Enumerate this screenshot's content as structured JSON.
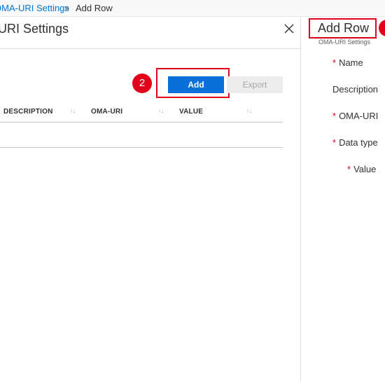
{
  "breadcrumb": {
    "parent": "OMA-URI Settings",
    "separator": ">",
    "current": "Add Row"
  },
  "left_blade": {
    "title": "URI Settings",
    "toolbar": {
      "add_label": "Add",
      "export_label": "Export"
    },
    "callout_number": "2",
    "table": {
      "columns": [
        {
          "label": "DESCRIPTION",
          "sort": "↑↓"
        },
        {
          "label": "OMA-URI",
          "sort": "↑↓"
        },
        {
          "label": "VALUE",
          "sort": "↑↓"
        }
      ]
    }
  },
  "right_blade": {
    "title": "Add Row",
    "subtitle": "OMA-URI Settings",
    "fields": [
      {
        "label": "Name",
        "required": "*"
      },
      {
        "label": "Description",
        "required": ""
      },
      {
        "label": "OMA-URI",
        "required": "*"
      },
      {
        "label": "Data type",
        "required": "*"
      },
      {
        "label": "Value",
        "required": "*"
      }
    ]
  },
  "colors": {
    "accent": "#0a6fd8",
    "callout": "#e3001b",
    "link": "#0078d4"
  },
  "icons": {
    "close": "close-icon",
    "sort": "sort-icon"
  }
}
